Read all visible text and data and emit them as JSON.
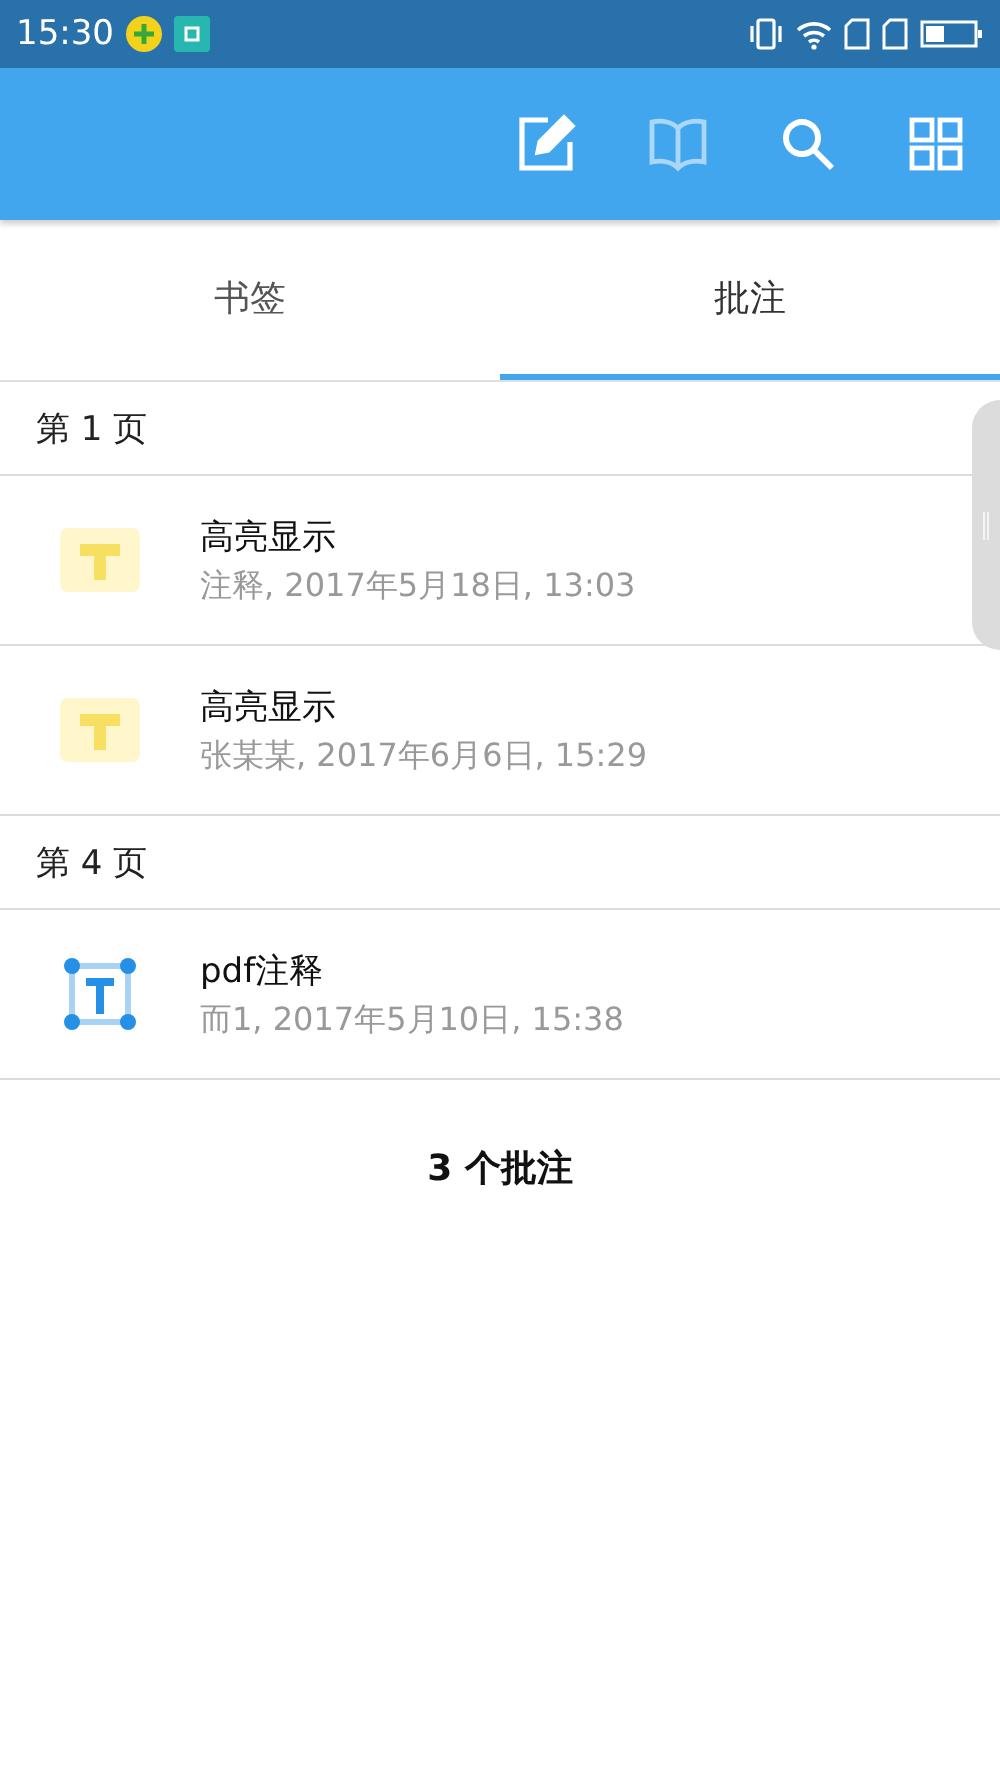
{
  "status_bar": {
    "time": "15:30"
  },
  "toolbar": {
    "actions": [
      {
        "kind": "edit",
        "disabled": false
      },
      {
        "kind": "book",
        "disabled": true
      },
      {
        "kind": "search",
        "disabled": false
      },
      {
        "kind": "grid",
        "disabled": false
      }
    ]
  },
  "tabs": [
    {
      "label": "书签",
      "selected": false
    },
    {
      "label": "批注",
      "selected": true
    }
  ],
  "sections": [
    {
      "heading": "第 1 页",
      "items": [
        {
          "kind": "highlight",
          "title": "高亮显示",
          "detail": "注释, 2017年5月18日, 13:03"
        },
        {
          "kind": "highlight",
          "title": "高亮显示",
          "detail": "张某某, 2017年6月6日, 15:29"
        }
      ]
    },
    {
      "heading": "第 4 页",
      "items": [
        {
          "kind": "text",
          "title": "pdf注释",
          "detail": "而1, 2017年5月10日, 15:38"
        }
      ]
    }
  ],
  "summary": "3 个批注"
}
